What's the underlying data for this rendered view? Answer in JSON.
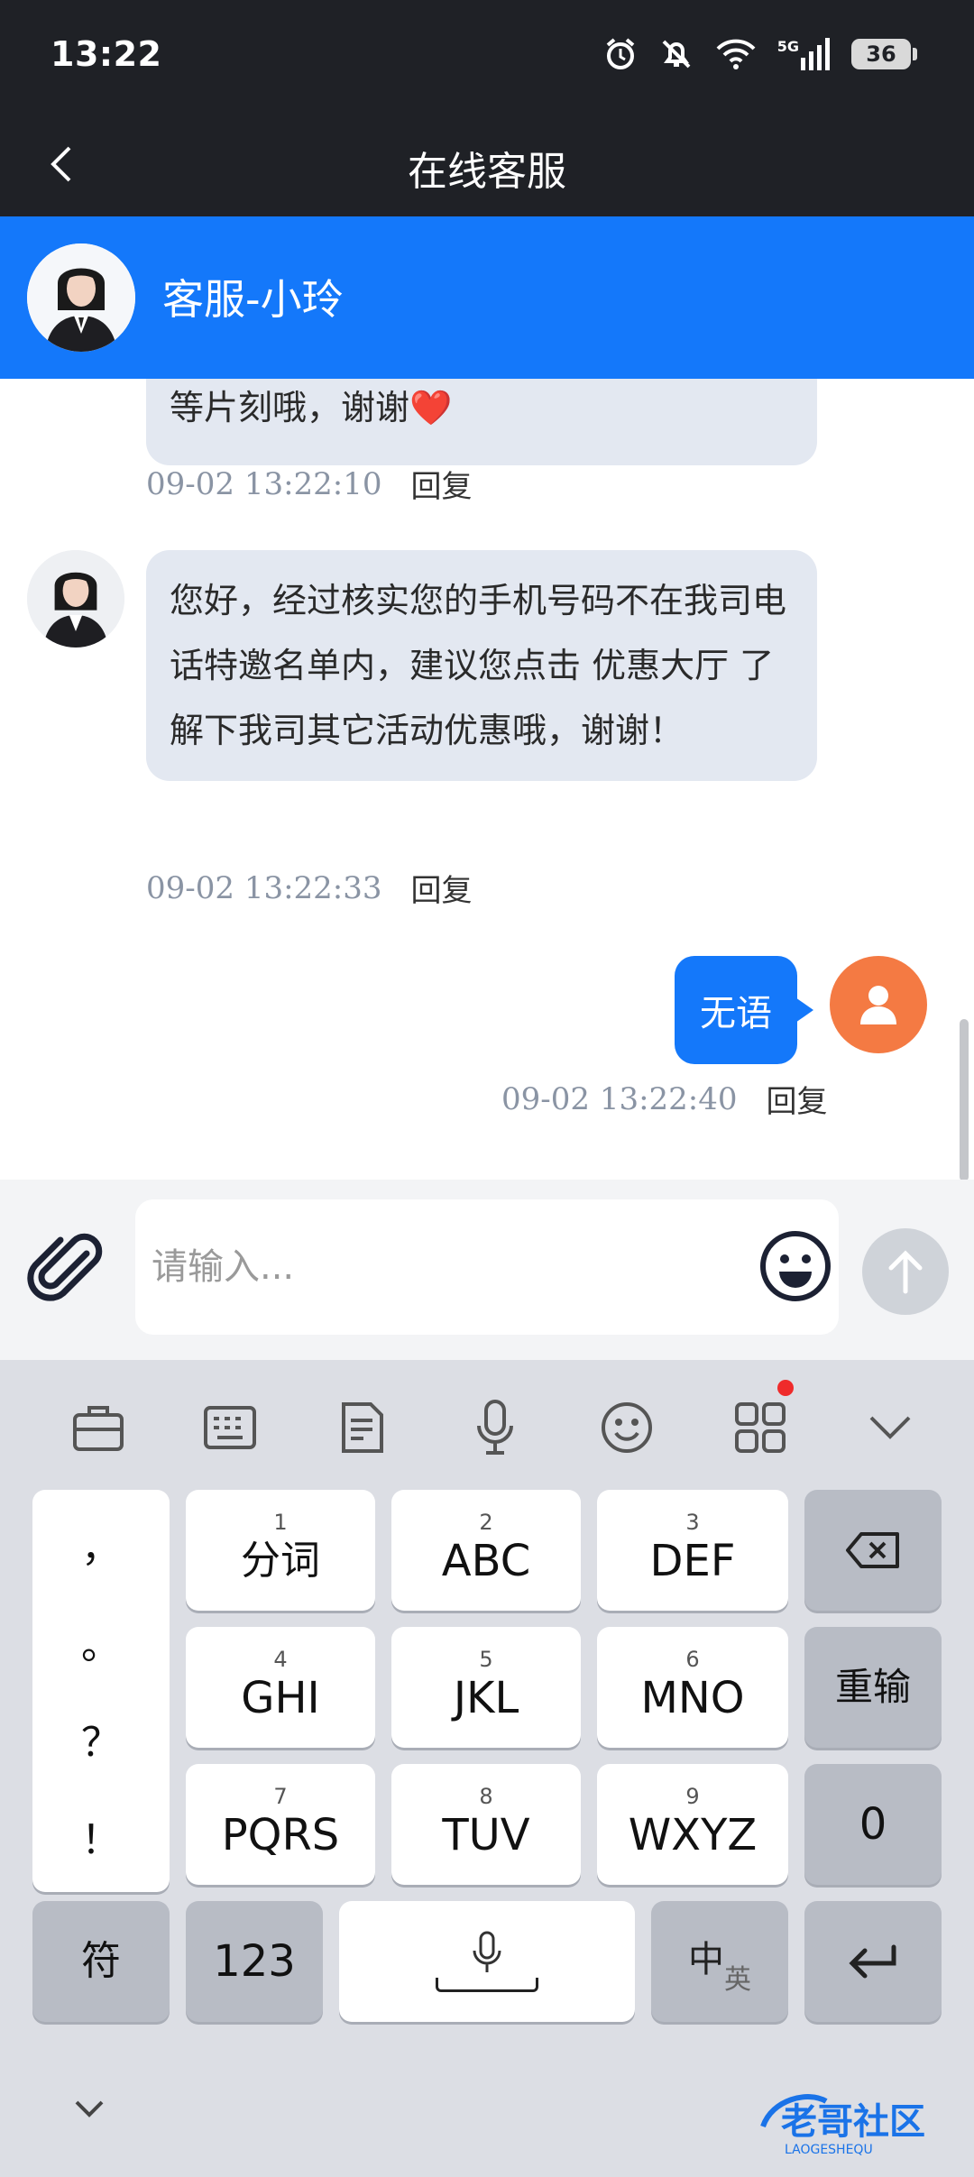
{
  "status_bar": {
    "time": "13:22",
    "network": "5G",
    "battery": "36",
    "icons": [
      "alarm-icon",
      "mute-icon",
      "wifi-icon",
      "signal-icon",
      "battery-icon"
    ]
  },
  "header": {
    "title": "在线客服",
    "back_icon": "chevron-left-icon"
  },
  "agent": {
    "name": "客服-小玲",
    "avatar_icon": "agent-avatar"
  },
  "messages": [
    {
      "sender": "agent",
      "text": "等片刻哦，谢谢",
      "emoji": "❤️",
      "time": "09-02 13:22:10",
      "reply_label": "回复"
    },
    {
      "sender": "agent",
      "text": "您好，经过核实您的手机号码不在我司电话特邀名单内，建议您点击 优惠大厅 了解下我司其它活动优惠哦，谢谢！",
      "time": "09-02 13:22:33",
      "reply_label": "回复"
    },
    {
      "sender": "user",
      "text": "无语",
      "time": "09-02 13:22:40",
      "reply_label": "回复"
    }
  ],
  "input": {
    "placeholder": "请输入...",
    "attach_icon": "paperclip-icon",
    "emoji_icon": "smiley-icon",
    "send_icon": "arrow-up-icon"
  },
  "keyboard": {
    "toolbar": [
      "briefcase-icon",
      "keyboard-icon",
      "clipboard-icon",
      "microphone-icon",
      "emoji-icon",
      "apps-icon",
      "chevron-down-icon"
    ],
    "punctuation": [
      "，",
      "。",
      "？",
      "！"
    ],
    "keys": [
      {
        "num": "1",
        "label": "分词"
      },
      {
        "num": "2",
        "label": "ABC"
      },
      {
        "num": "3",
        "label": "DEF"
      },
      {
        "num": "4",
        "label": "GHI"
      },
      {
        "num": "5",
        "label": "JKL"
      },
      {
        "num": "6",
        "label": "MNO"
      },
      {
        "num": "7",
        "label": "PQRS"
      },
      {
        "num": "8",
        "label": "TUV"
      },
      {
        "num": "9",
        "label": "WXYZ"
      }
    ],
    "side_keys": {
      "backspace_icon": "backspace-icon",
      "reenter": "重输",
      "zero": "0",
      "enter_icon": "enter-icon"
    },
    "bottom_row": {
      "symbols": "符",
      "numbers": "123",
      "space_icon": "microphone-icon",
      "lang_primary": "中",
      "lang_secondary": "英"
    },
    "hide_icon": "chevron-down-icon"
  },
  "watermark": {
    "text": "老哥社区",
    "subtext": "LAOGESHEQU"
  },
  "colors": {
    "brand_blue": "#1478fa",
    "dark_bar": "#1f2126",
    "agent_bubble": "#e3e8f1",
    "user_avatar": "#f47a43"
  }
}
